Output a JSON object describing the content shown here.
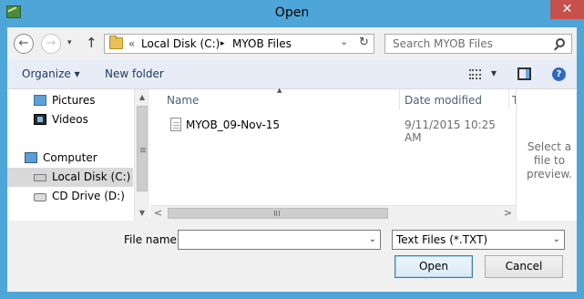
{
  "window": {
    "title": "Open",
    "close_glyph": "✕"
  },
  "nav": {
    "back_glyph": "←",
    "forward_glyph": "→",
    "recent_glyph": "▾",
    "up_glyph": "↑"
  },
  "address": {
    "prefix": "«",
    "crumbs": [
      "Local Disk (C:)",
      "MYOB Files"
    ],
    "separator": "▸",
    "dropdown_glyph": "⌄",
    "refresh_glyph": "↻"
  },
  "search": {
    "placeholder": "Search MYOB Files"
  },
  "toolbar": {
    "organize_label": "Organize ▾",
    "new_folder_label": "New folder",
    "views_dropdown_glyph": "▾",
    "help_glyph": "?"
  },
  "navpane": {
    "items": [
      {
        "label": "Pictures",
        "icon": "pictures-icon"
      },
      {
        "label": "Videos",
        "icon": "videos-icon"
      },
      {
        "label": "Computer",
        "icon": "computer-icon"
      },
      {
        "label": "Local Disk (C:)",
        "icon": "local-disk-icon",
        "selected": true
      },
      {
        "label": "CD Drive (D:)",
        "icon": "cd-drive-icon"
      }
    ],
    "scroll_up": "▲",
    "scroll_down": "▼"
  },
  "list": {
    "columns": [
      "Name",
      "Date modified",
      "T"
    ],
    "sort_glyph": "▲",
    "files": [
      {
        "name": "MYOB_09-Nov-15",
        "date_modified": "9/11/2015 10:25 AM"
      }
    ],
    "scroll_left": "<",
    "scroll_right": ">"
  },
  "preview": {
    "text": "Select a file to preview."
  },
  "bottom": {
    "file_name_label": "File name:",
    "file_name_value": "",
    "filter_value": "Text Files (*.TXT)",
    "open_label": "Open",
    "cancel_label": "Cancel",
    "dropdown_glyph": "⌄"
  },
  "colors": {
    "titlebar": "#4ea6d8",
    "close_button": "#c7504c",
    "toolbar": "#e8ecf7",
    "selection": "#d9d9d9"
  }
}
